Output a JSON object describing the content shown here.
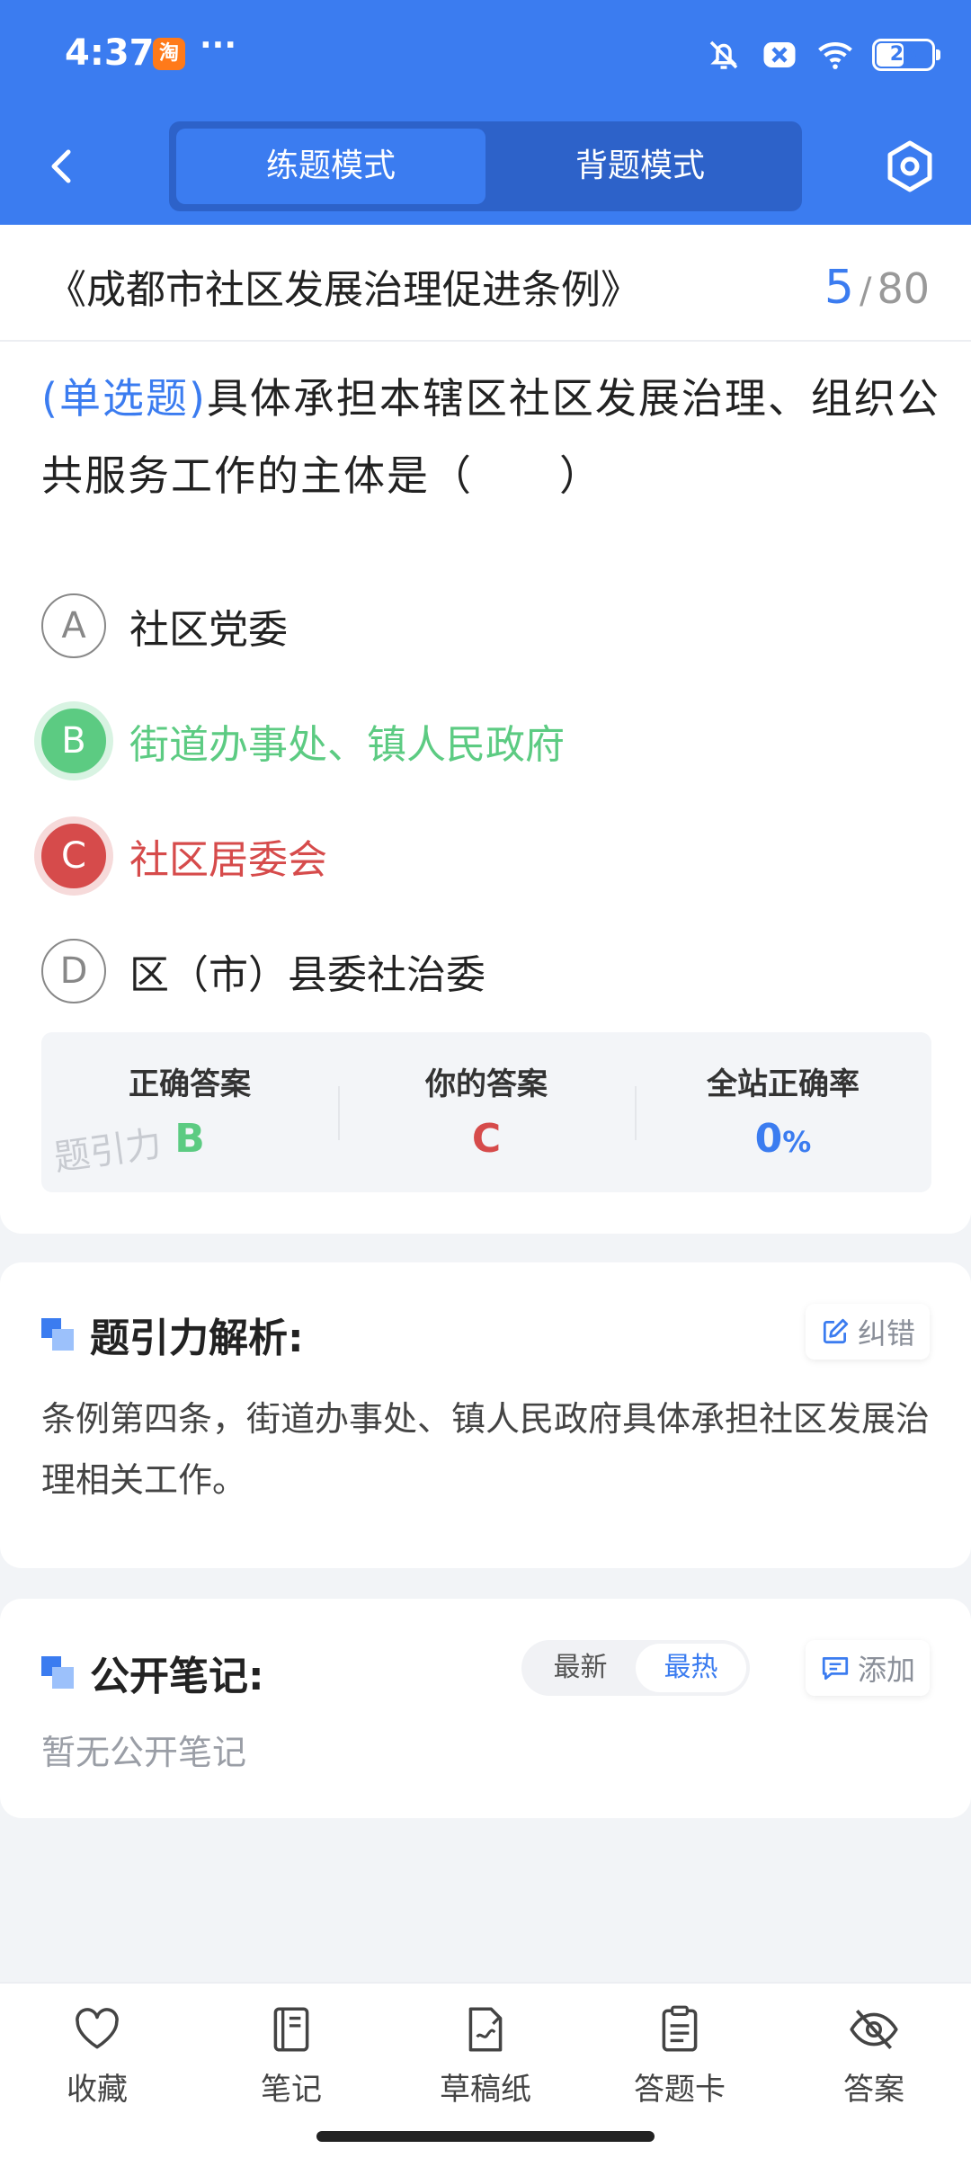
{
  "status_bar": {
    "time": "4:37",
    "app_icon_label": "淘",
    "more": "···",
    "battery": "23",
    "icons": [
      "bell-muted-icon",
      "close-box-icon",
      "wifi-icon",
      "battery-icon"
    ]
  },
  "nav": {
    "tabs": [
      {
        "label": "练题模式",
        "active": true
      },
      {
        "label": "背题模式",
        "active": false
      }
    ],
    "back_icon": "chevron-left-icon",
    "settings_icon": "hexagon-settings-icon"
  },
  "question_header": {
    "doc_title": "《成都市社区发展治理促进条例》",
    "current": "5",
    "separator": "/",
    "total": "80"
  },
  "question": {
    "type_label": "(单选题)",
    "text": "具体承担本辖区社区发展治理、组织公共服务工作的主体是（　　）",
    "options": [
      {
        "letter": "A",
        "text": "社区党委",
        "state": "normal"
      },
      {
        "letter": "B",
        "text": "街道办事处、镇人民政府",
        "state": "correct"
      },
      {
        "letter": "C",
        "text": "社区居委会",
        "state": "wrong"
      },
      {
        "letter": "D",
        "text": "区（市）县委社治委",
        "state": "normal"
      }
    ]
  },
  "answer_summary": {
    "correct_label": "正确答案",
    "correct_value": "B",
    "yours_label": "你的答案",
    "yours_value": "C",
    "rate_label": "全站正确率",
    "rate_value": "0",
    "rate_unit": "%",
    "watermark": "题引力",
    "colors": {
      "correct": "#5ccb82",
      "wrong": "#d64b4b",
      "accent": "#3b7cf0"
    }
  },
  "analysis": {
    "title": "题引力解析:",
    "report_button": "纠错",
    "text": "条例第四条，街道办事处、镇人民政府具体承担社区发展治理相关工作。"
  },
  "notes": {
    "title": "公开笔记:",
    "sort_options": [
      {
        "label": "最新",
        "active": false
      },
      {
        "label": "最热",
        "active": true
      }
    ],
    "add_button": "添加",
    "empty_text": "暂无公开笔记"
  },
  "toolbar": {
    "items": [
      {
        "label": "收藏",
        "icon": "heart-icon"
      },
      {
        "label": "笔记",
        "icon": "notebook-icon"
      },
      {
        "label": "草稿纸",
        "icon": "draft-paper-icon"
      },
      {
        "label": "答题卡",
        "icon": "answer-sheet-icon"
      },
      {
        "label": "答案",
        "icon": "eye-hidden-icon"
      }
    ]
  }
}
